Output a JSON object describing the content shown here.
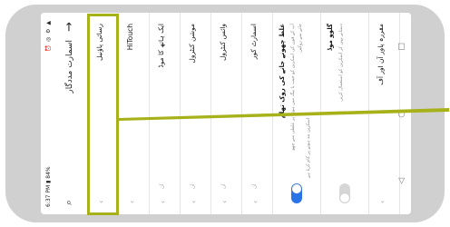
{
  "status_bar": {
    "time": "6:37 PM",
    "battery": "84%",
    "icons": "⏰ ◎ ⚙ ▲"
  },
  "header": {
    "title": "اسمارت مددگار",
    "back_icon": "arrow-back-icon",
    "search_icon": "search-icon"
  },
  "items": [
    {
      "label": "رسائی پاؤنیل",
      "value": "",
      "selected": true
    },
    {
      "label": "HiTouch",
      "value": ""
    },
    {
      "label": "ایک ہاتھ کا موڈ",
      "value": "آن"
    },
    {
      "label": "موشن کنٹرول",
      "value": "آن"
    },
    {
      "label": "وائس کنٹرول",
      "value": "آن"
    },
    {
      "label": "اسمارٹ کور",
      "value": "آن"
    }
  ],
  "toggles": [
    {
      "label": "غلط چھونے جانے کی روک تھام",
      "desc": "آپ کے فون کی اسکرین کو جیب یا بیگ میں ہونے پر غلطی سے چھو جانے سے روکیں",
      "sub": "اسکرین بند ہونے پر کام کرتا ہے",
      "on": true
    },
    {
      "label": "گلوو موڈ",
      "desc": "دستانے پہن کر اسکرین کو استعمال کریں",
      "sub": "",
      "on": false
    }
  ],
  "last_item": {
    "label": "مقررہ پاور آن اور آف"
  },
  "nav": {
    "back": "◁",
    "home": "○",
    "recent": "□"
  },
  "colors": {
    "highlight": "#a7b21a",
    "accent": "#2a74e8",
    "frame": "#d0d0d0"
  }
}
